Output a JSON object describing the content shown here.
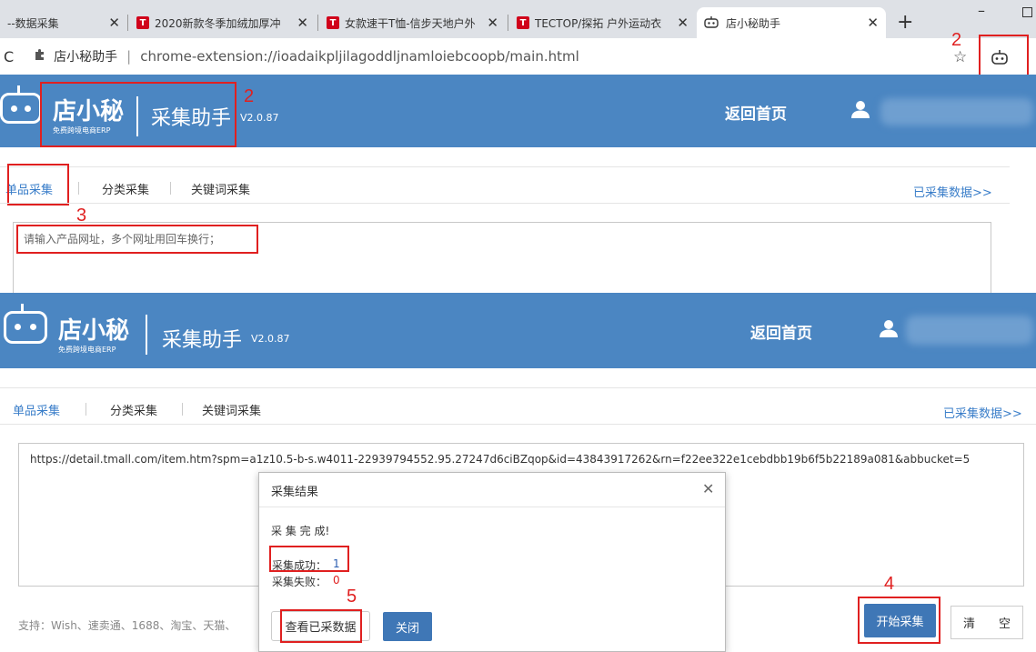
{
  "browser": {
    "tabs": [
      {
        "label": "--数据采集"
      },
      {
        "label": "2020新款冬季加绒加厚冲"
      },
      {
        "label": "女款速干T恤-信步天地户外"
      },
      {
        "label": "TECTOP/探拓 户外运动衣"
      },
      {
        "label": "店小秘助手"
      }
    ],
    "tab_icon_letter": "T",
    "new_tab": "+",
    "minimize": "–",
    "page_title": "店小秘助手",
    "url": "chrome-extension://ioadaikpljilagoddljnamloiebcoopb/main.html",
    "reload": "C"
  },
  "header": {
    "brand": "店小秘",
    "brand_sub": "免费跨境电商ERP",
    "app_title": "采集助手",
    "version": "V2.0.87",
    "home": "返回首页"
  },
  "tabs": {
    "single": "单品采集",
    "category": "分类采集",
    "keyword": "关键词采集",
    "collected": "已采集数据>>"
  },
  "input": {
    "placeholder": "请输入产品网址，多个网址用回车换行；",
    "value": "https://detail.tmall.com/item.htm?spm=a1z10.5-b-s.w4011-22939794552.95.27247d6ciBZqop&id=43843917262&rn=f22ee322e1cebdbb19b6f5b22189a081&abbucket=5"
  },
  "support": "支持：Wish、速卖通、1688、淘宝、天猫、",
  "buttons": {
    "start": "开始采集",
    "clear": "清　　空"
  },
  "modal": {
    "title": "采集结果",
    "close": "✕",
    "done": "采 集 完 成!",
    "success_label": "采集成功：",
    "success_value": "1",
    "fail_label": "采集失败：",
    "fail_value": "0",
    "view_button": "查看已采数据",
    "close_button": "关闭"
  },
  "annotations": {
    "n2a": "2",
    "n2b": "2",
    "n3": "3",
    "n4": "4",
    "n5": "5"
  },
  "colors": {
    "header_blue": "#4b86c2",
    "link_blue": "#3a7ec9",
    "button_blue": "#3f77b6",
    "annotation_red": "#e02020"
  }
}
